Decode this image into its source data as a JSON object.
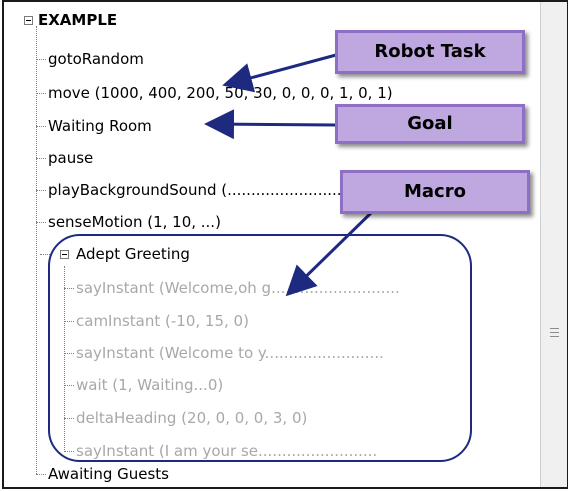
{
  "tree": {
    "root": "EXAMPLE",
    "items": [
      {
        "label": "gotoRandom"
      },
      {
        "label": "move (1000, 400, 200, 50, 30, 0, 0, 0, 1, 0, 1)"
      },
      {
        "label": "Waiting Room"
      },
      {
        "label": "pause"
      },
      {
        "label": "playBackgroundSound (........................................mi"
      },
      {
        "label": "senseMotion (1, 10, ...)"
      },
      {
        "label": "Adept Greeting"
      },
      {
        "label": "sayInstant (Welcome,oh g..........................."
      },
      {
        "label": "camInstant (-10, 15, 0)"
      },
      {
        "label": "sayInstant (Welcome to y........................."
      },
      {
        "label": "wait (1, Waiting...0)"
      },
      {
        "label": "deltaHeading (20, 0, 0, 0, 3, 0)"
      },
      {
        "label": "sayInstant (I am your se........................."
      },
      {
        "label": "Awaiting Guests"
      }
    ]
  },
  "annotations": {
    "robot_task": "Robot Task",
    "goal": "Goal",
    "macro": "Macro"
  },
  "colors": {
    "callout_fill": "#bfa8df",
    "callout_border": "#8e6fc3",
    "arrow": "#1e2a80",
    "disabled_text": "#a8a8a8"
  }
}
